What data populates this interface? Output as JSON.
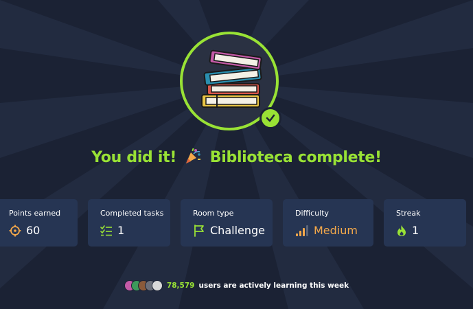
{
  "completion": {
    "title_prefix": "You did it!",
    "title_suffix": "Biblioteca complete!",
    "badge_icon": "book-stack-icon",
    "check_icon": "checkmark-icon",
    "party_icon": "party-popper-icon"
  },
  "stats": [
    {
      "label": "Points earned",
      "value": "60",
      "icon": "target-icon"
    },
    {
      "label": "Completed tasks",
      "value": "1",
      "icon": "checklist-icon"
    },
    {
      "label": "Room type",
      "value": "Challenge",
      "icon": "flag-icon"
    },
    {
      "label": "Difficulty",
      "value": "Medium",
      "icon": "signal-bars-icon"
    },
    {
      "label": "Streak",
      "value": "1",
      "icon": "flame-icon"
    }
  ],
  "footer": {
    "count": "78,579",
    "text": "users are actively learning this week"
  },
  "colors": {
    "accent": "#99e235",
    "card_bg": "#263553",
    "page_bg": "#1b2234",
    "difficulty": "#f5a94a"
  }
}
